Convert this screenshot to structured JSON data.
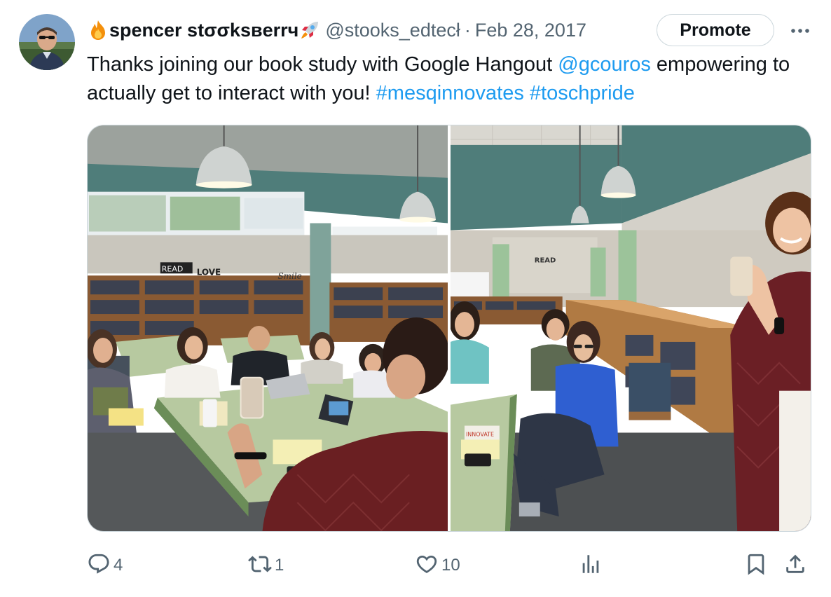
{
  "author": {
    "display_name": "spencer stσσksвerrч",
    "handle": "@stooks_edtecł",
    "separator": "·",
    "date": "Feb 28, 2017",
    "leading_emoji": "fire-icon",
    "trailing_emoji": "rocket-icon"
  },
  "header": {
    "promote_label": "Promote",
    "more_icon": "more-horizontal-icon"
  },
  "tweet": {
    "text_1": "Thanks joining our book study with Google Hangout ",
    "mention": "@gcouros",
    "text_2": " empowering to actually get to interact with you! ",
    "hashtag_1": "#mesqinnovates",
    "space": " ",
    "hashtag_2": "#toschpride"
  },
  "media": {
    "photo_1": {
      "wall_sign_read": "READ",
      "wall_sign_love": "LOVE",
      "wall_sign_smile": "Smile"
    },
    "photo_2": {
      "wall_sign_read": "READ",
      "laptop_sticker": "INNOVATE"
    }
  },
  "actions": {
    "reply_count": "4",
    "retweet_count": "1",
    "like_count": "10"
  },
  "colors": {
    "link": "#1d9bf0",
    "secondary_text": "#536471",
    "primary_text": "#0f1419",
    "border": "#cfd9de"
  }
}
